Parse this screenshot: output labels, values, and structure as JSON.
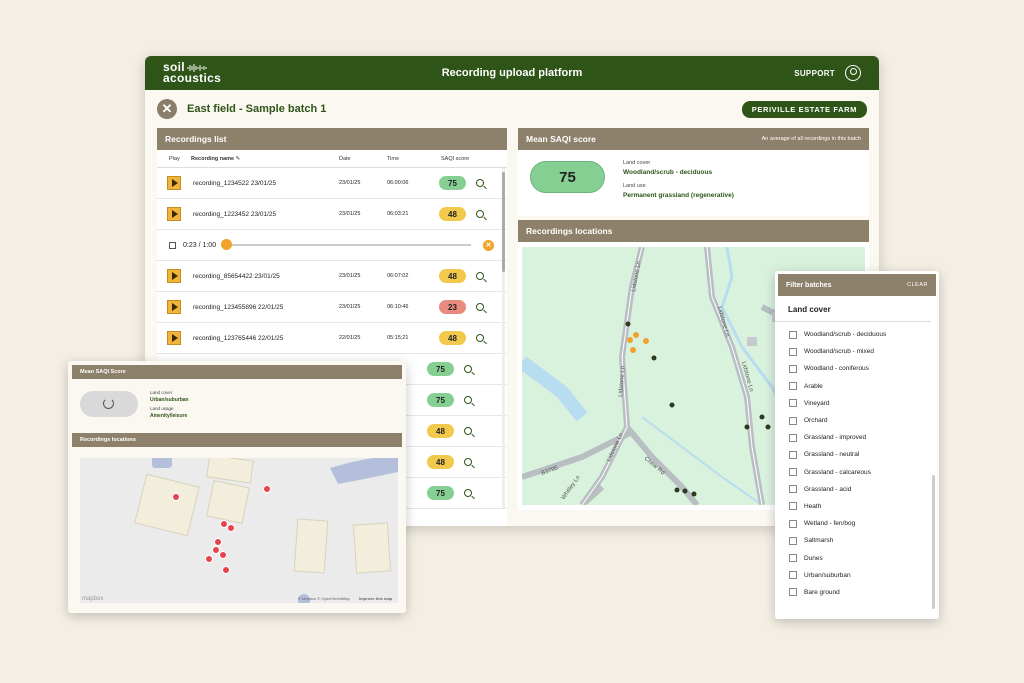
{
  "app": {
    "logo_line1": "soil",
    "logo_line2": "acoustics",
    "title": "Recording upload platform",
    "support": "SUPPORT"
  },
  "batch": {
    "title": "East field - Sample batch 1",
    "farm": "PERIVILLE ESTATE FARM"
  },
  "recordings": {
    "title": "Recordings list",
    "columns": {
      "play": "Play",
      "name": "Recording name",
      "date": "Date",
      "time": "Time",
      "score": "SAQI score"
    },
    "rows": [
      {
        "name": "recording_1234522 23/01/25",
        "date": "23/01/25",
        "time": "06:00:06",
        "score": "75",
        "color": "#86cf93"
      },
      {
        "name": "recording_1223452 23/01/25",
        "date": "23/01/25",
        "time": "06:03:21",
        "score": "48",
        "color": "#f2c94c"
      },
      {
        "name": "recording_85654422 23/01/25",
        "date": "23/01/25",
        "time": "06:07:02",
        "score": "48",
        "color": "#f2c94c"
      },
      {
        "name": "recording_123455896 22/01/25",
        "date": "23/01/25",
        "time": "06:10:46",
        "score": "23",
        "color": "#e88b7e"
      },
      {
        "name": "recording_123765446 22/01/25",
        "date": "22/01/25",
        "time": "05:15:21",
        "score": "48",
        "color": "#f2c94c"
      }
    ],
    "partial_badges": [
      {
        "score": "75",
        "color": "#86cf93"
      },
      {
        "score": "75",
        "color": "#86cf93"
      },
      {
        "score": "48",
        "color": "#f2c94c"
      },
      {
        "score": "48",
        "color": "#f2c94c"
      },
      {
        "score": "75",
        "color": "#86cf93"
      }
    ],
    "player": {
      "time": "0:23 / 1:00",
      "progress": 0.0
    }
  },
  "mean_score": {
    "title": "Mean SAQI score",
    "subtitle": "An average of all recordings in this batch",
    "value": "75",
    "land_cover_label": "Land cover",
    "land_cover_value": "Woodland/scrub - deciduous",
    "land_use_label": "Land use",
    "land_use_value": "Permanent grassland (regenerative)"
  },
  "locations": {
    "title": "Recordings locations",
    "roads": [
      "Lidstone Ln",
      "Lidstone Ln",
      "Lidstone Ln",
      "Lidstone Ln",
      "Lidstone Ln",
      "B3795",
      "Whitley Ln",
      "Chew Rd"
    ]
  },
  "overlay_left": {
    "score_title": "Mean SAQI Score",
    "land_cover_label": "Land cover",
    "land_cover_value": "Urban/suburban",
    "land_use_label": "Land usage",
    "land_use_value": "Amenity/leisure",
    "locations_title": "Recordings locations",
    "map_brand": "mapbox",
    "attribution": "© Mapbox © OpenStreetMap",
    "improve": "Improve this map"
  },
  "filter": {
    "title": "Filter batches",
    "clear": "CLEAR",
    "section": "Land cover",
    "options": [
      "Woodland/scrub - deciduous",
      "Woodland/scrub - mixed",
      "Woodland - coniferous",
      "Arable",
      "Vineyard",
      "Orchard",
      "Grassland - improved",
      "Grassland - neutral",
      "Grassland - calcareous",
      "Grassland - acid",
      "Heath",
      "Wetland - fen/bog",
      "Saltmarsh",
      "Dunes",
      "Urban/suburban",
      "Bare ground"
    ]
  },
  "colors": {
    "brand_green": "#2e5418",
    "panel_header": "#8e816b",
    "play_orange": "#f2b33d",
    "map_green": "#d9f2de",
    "map_water": "#b8dcf0",
    "marker_dark": "#2b3a1d",
    "marker_orange": "#f2a12a",
    "marker_red": "#e8424d"
  }
}
